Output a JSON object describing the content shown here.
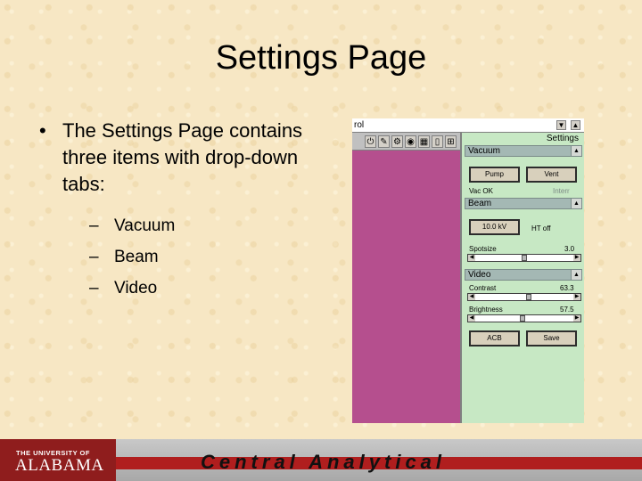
{
  "slide": {
    "title": "Settings Page",
    "bullet": "The Settings Page contains three items with drop-down tabs:",
    "sub_items": [
      "Vacuum",
      "Beam",
      "Video"
    ]
  },
  "app": {
    "title_fragment": "rol",
    "settings_caption": "Settings",
    "left_pane_color": "#b54f8e",
    "right_pane_color": "#c7e8c4",
    "toolbar_icons": [
      "power-icon",
      "beam-icon",
      "stage-icon",
      "grid-icon",
      "split-icon"
    ],
    "vacuum": {
      "header": "Vacuum",
      "pump_label": "Pump",
      "vent_label": "Vent",
      "status": "Vac OK",
      "status_right": "Interr"
    },
    "beam": {
      "header": "Beam",
      "kv_label": "10.0 kV",
      "ht_status": "HT off",
      "spotsize_label": "Spotsize",
      "spotsize_value": "3.0",
      "spotsize_level": 0.5
    },
    "video": {
      "header": "Video",
      "contrast_label": "Contrast",
      "contrast_value": "63.3",
      "contrast_level": 0.55,
      "brightness_label": "Brightness",
      "brightness_value": "57.5",
      "brightness_level": 0.48,
      "acb_label": "ACB",
      "save_label": "Save"
    }
  },
  "footer": {
    "university_small": "THE UNIVERSITY OF",
    "university_big": "ALABAMA",
    "tagline": "Central Analytical"
  }
}
